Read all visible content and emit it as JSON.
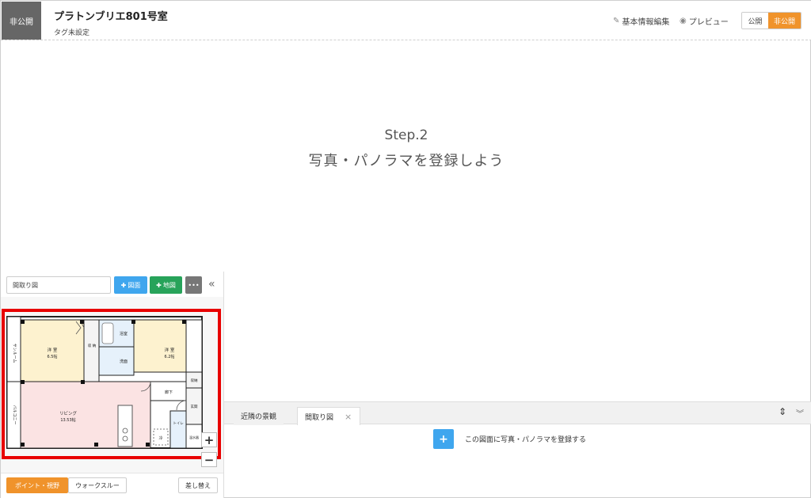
{
  "header": {
    "status": "非公開",
    "title": "プラトンブリエ801号室",
    "tags": "タグ未設定",
    "edit_info_label": "基本情報編集",
    "edit_icon": "pencil-icon",
    "preview_label": "プレビュー",
    "preview_icon": "eye-icon",
    "publish_toggle": {
      "public_label": "公開",
      "private_label": "非公開",
      "selected": "非公開"
    }
  },
  "main": {
    "step_number": "Step.2",
    "step_message": "写真・パノラマを登録しよう"
  },
  "left_panel": {
    "plan_select_value": "間取り図",
    "add_plan_label": "図面",
    "add_map_label": "地図",
    "more_label": "•••",
    "collapse_icon": "«",
    "floorplan": {
      "sunroom": "サンルーム",
      "balcony": "バルコニー",
      "room1_name": "洋 室",
      "room1_size": "6.5帖",
      "storage1": "収 納",
      "bath": "浴室",
      "washroom": "洗面",
      "room2_name": "洋 室",
      "room2_size": "6.2帖",
      "storage2": "収納",
      "hallway": "廊下",
      "living_name": "リビング",
      "living_size": "13.53帖",
      "entrance": "玄関",
      "toilet": "トイレ",
      "fridge": "冷",
      "water_heater": "温水器"
    },
    "zoom_in": "+",
    "zoom_out": "−",
    "mode_point": "ポイント・視野",
    "mode_walk": "ウォークスルー",
    "swap_label": "差し替え"
  },
  "bottom_panel": {
    "tabs": [
      {
        "label": "近隣の景観"
      },
      {
        "label": "間取り図"
      }
    ],
    "active_tab": "間取り図",
    "add_label": "この図面に写真・パノラマを登録する"
  },
  "colors": {
    "accent_orange": "#f0932b",
    "blue": "#3fa6ee",
    "green": "#27a35a",
    "highlight_red": "#e80000"
  }
}
